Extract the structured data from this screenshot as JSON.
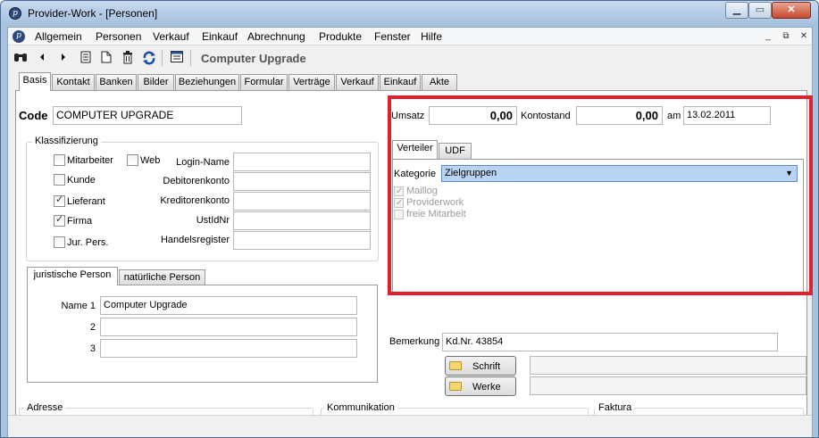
{
  "window": {
    "title": "Provider-Work - [Personen]",
    "min": "▁",
    "max": "▭",
    "close": "✕"
  },
  "menu": {
    "items": [
      "Allgemein",
      "Personen",
      "Verkauf",
      "Einkauf",
      "Abrechnung",
      "Produkte",
      "Fenster",
      "Hilfe"
    ],
    "mdi": [
      "_",
      "⧉",
      "✕"
    ]
  },
  "toolbar": {
    "record_title": "Computer Upgrade",
    "icons": [
      "binoculars-icon",
      "prev-icon",
      "next-icon",
      "document-icon",
      "new-icon",
      "trash-icon",
      "refresh-icon",
      "list-icon"
    ]
  },
  "tabs": [
    "Basis",
    "Kontakt",
    "Banken",
    "Bilder",
    "Beziehungen",
    "Formular",
    "Verträge",
    "Verkauf",
    "Einkauf",
    "Akte"
  ],
  "basis": {
    "code_label": "Code",
    "code_value": "COMPUTER UPGRADE",
    "umsatz_label": "Umsatz",
    "umsatz_value": "0,00",
    "kontostand_label": "Kontostand",
    "kontostand_value": "0,00",
    "am_label": "am",
    "am_value": "13.02.2011",
    "klass_title": "Klassifizierung",
    "checks": {
      "mitarbeiter": "Mitarbeiter",
      "web": "Web",
      "kunde": "Kunde",
      "lieferant": "Lieferant",
      "firma": "Firma",
      "jur": "Jur. Pers."
    },
    "fields": {
      "login": "Login-Name",
      "debitor": "Debitorenkonto",
      "kreditor": "Kreditorenkonto",
      "ustid": "UstIdNr",
      "handels": "Handelsregister"
    },
    "person_tabs": [
      "juristische Person",
      "natürliche Person"
    ],
    "name1_label": "Name 1",
    "name1_value": "Computer Upgrade",
    "name2_label": "2",
    "name3_label": "3",
    "verteiler_tabs": [
      "Verteiler",
      "UDF"
    ],
    "kategorie_label": "Kategorie",
    "kategorie_value": "Zielgruppen",
    "verteiler_items": [
      "Maillog",
      "Providerwork",
      "freie Mitarbeit"
    ],
    "bemerkung_label": "Bemerkung",
    "bemerkung_value": "Kd.Nr. 43854",
    "schrift_label": "Schrift",
    "werke_label": "Werke",
    "bottom_groups": [
      "Adresse",
      "Kommunikation",
      "Faktura"
    ]
  },
  "colors": {
    "highlight": "#e0202a",
    "selected_field": "#b9d4f2",
    "titlebar": "#a9c3de"
  }
}
